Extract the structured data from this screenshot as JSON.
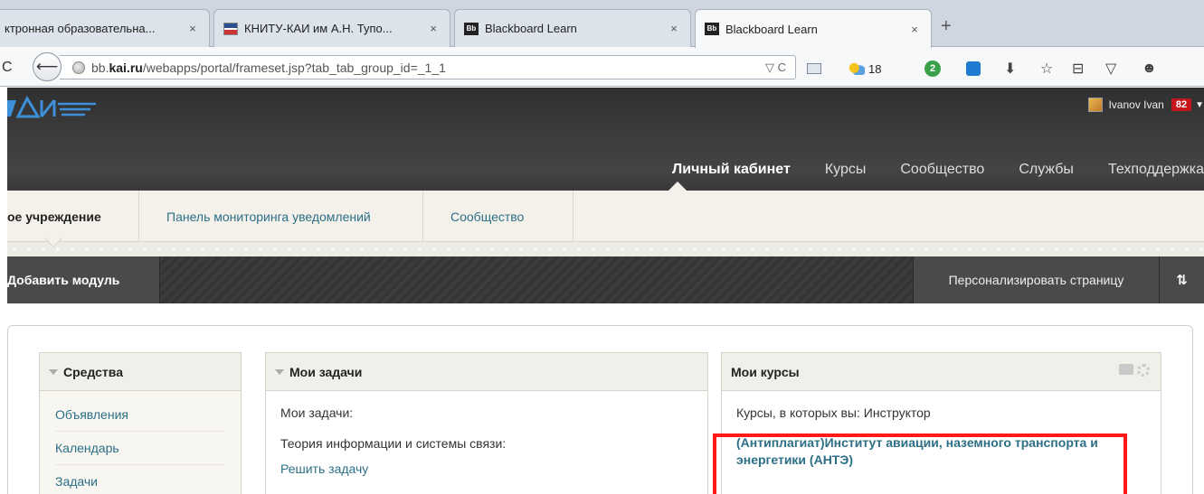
{
  "browser": {
    "tabs": [
      {
        "title": "ктронная образовательна...",
        "icon": "document-icon"
      },
      {
        "title": "КНИТУ-КАИ им А.Н. Тупо...",
        "icon": "kai-flag-icon"
      },
      {
        "title": "Blackboard Learn",
        "icon": "blackboard-icon"
      },
      {
        "title": "Blackboard Learn",
        "icon": "blackboard-icon",
        "active": true
      }
    ],
    "tab_close": "×",
    "new_tab": "+",
    "bb_icon_text": "Bb",
    "nav_left_partial": "C",
    "back_glyph": "🡐",
    "url": {
      "host": "bb.",
      "host_bold": "kai.ru",
      "path": "/webapps/portal/frameset.jsp?tab_tab_group_id=_1_1",
      "controls": "▽ C"
    },
    "weather_temp": "18",
    "ext_badge": "2",
    "toolbar_icons": {
      "download": "⬇",
      "bookmark": "☆",
      "reader": "⊟",
      "pocket": "▽",
      "chat": "☻"
    }
  },
  "header": {
    "user_name": "Ivanov Ivan",
    "notifications": "82",
    "caret": "▼",
    "nav": [
      "Личный кабинет",
      "Курсы",
      "Сообщество",
      "Службы",
      "Техподдержка"
    ],
    "active_nav": "Личный кабинет"
  },
  "subtabs": [
    "Мое учреждение",
    "Панель мониторинга уведомлений",
    "Сообщество"
  ],
  "subtabs_display": [
    "ое учреждение",
    "Панель мониторинга уведомлений",
    "Сообщество"
  ],
  "actions": {
    "add_module": "Добавить модуль",
    "personalize": "Персонализировать страницу",
    "reorder": "⇅"
  },
  "modules": {
    "tools": {
      "title": "Средства",
      "links": [
        "Объявления",
        "Календарь",
        "Задачи"
      ]
    },
    "tasks": {
      "title": "Мои задачи",
      "lines": [
        "Мои задачи:",
        "Теория информации и системы связи:"
      ],
      "link": "Решить задачу"
    },
    "courses": {
      "title": "Мои курсы",
      "label": "Курсы, в которых вы: Инструктор",
      "course": "(Антиплагиат)Институт авиации, наземного транспорта и энергетики (АНТЭ)"
    }
  },
  "colors": {
    "accent_link": "#2c6f86",
    "header_bg": "#383838",
    "highlight": "#ff1a1a",
    "notif": "#c4161c"
  }
}
